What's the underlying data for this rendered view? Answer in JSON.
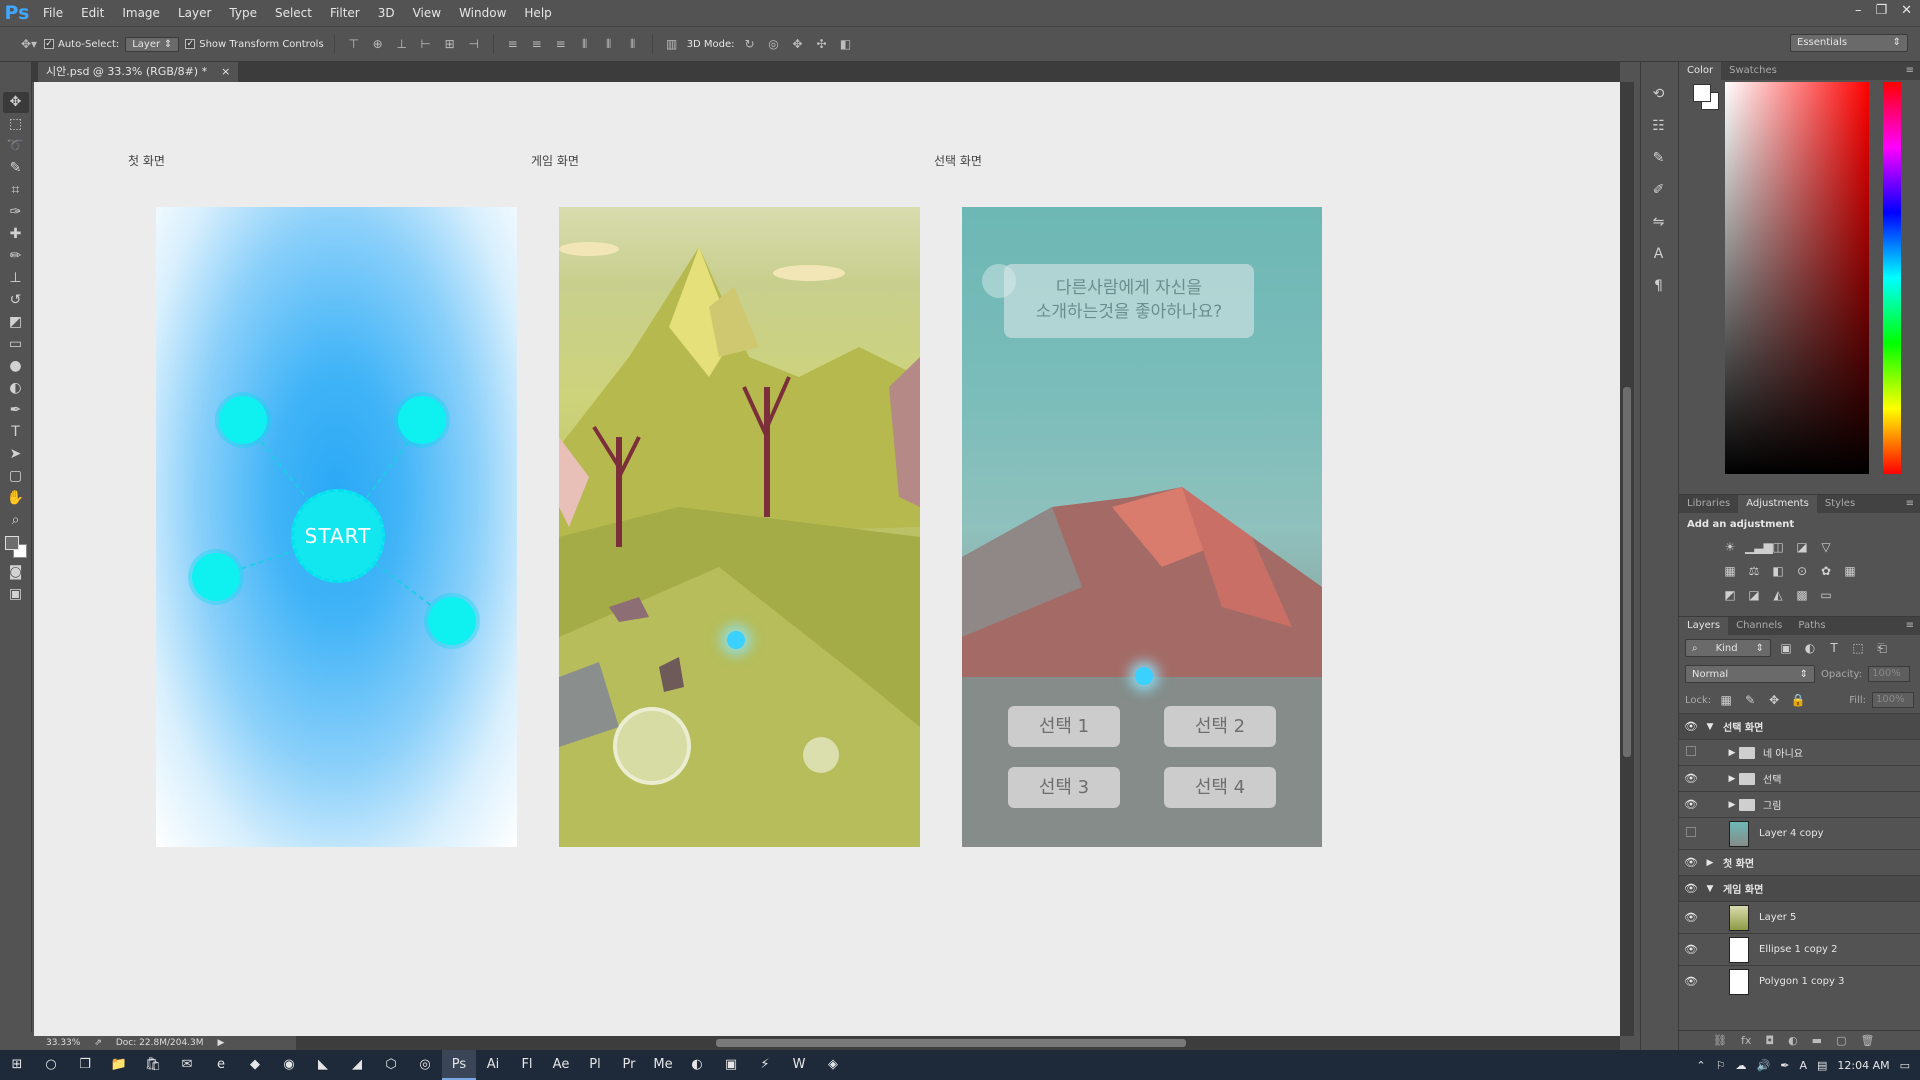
{
  "app": {
    "logo": "Ps",
    "menus": [
      "File",
      "Edit",
      "Image",
      "Layer",
      "Type",
      "Select",
      "Filter",
      "3D",
      "View",
      "Window",
      "Help"
    ]
  },
  "window_controls": {
    "minimize": "–",
    "restore": "❐",
    "close": "✕"
  },
  "options": {
    "auto_select": "Auto-Select:",
    "auto_select_target": "Layer",
    "show_transform": "Show Transform Controls",
    "mode_3d": "3D Mode:",
    "workspace": "Essentials"
  },
  "document": {
    "tab_title": "시안.psd @ 33.3% (RGB/8#) *",
    "close": "×",
    "zoom": "33.33%",
    "doc_size": "Doc: 22.8M/204.3M"
  },
  "artboards": {
    "first": {
      "label": "첫 화면",
      "start": "START"
    },
    "game": {
      "label": "게임 화면"
    },
    "select": {
      "label": "선택 화면",
      "question": "다른사람에게 자신을\n소개하는것을 좋아하나요?",
      "choices": [
        "선택 1",
        "선택 2",
        "선택 3",
        "선택 4"
      ]
    }
  },
  "color_panel": {
    "tabs": [
      "Color",
      "Swatches"
    ]
  },
  "adjust_panel": {
    "tabs": [
      "Libraries",
      "Adjustments",
      "Styles"
    ],
    "title": "Add an adjustment"
  },
  "layers_panel": {
    "tabs": [
      "Layers",
      "Channels",
      "Paths"
    ],
    "kind": "Kind",
    "blend": "Normal",
    "opacity_label": "Opacity:",
    "opacity_value": "100%",
    "lock_label": "Lock:",
    "fill_label": "Fill:",
    "fill_value": "100%",
    "layers": [
      {
        "name": "선택 화면",
        "type": "group",
        "expanded": true,
        "visible": true,
        "indent": 0
      },
      {
        "name": "네 아니요",
        "type": "group",
        "expanded": false,
        "visible": false,
        "indent": 1
      },
      {
        "name": "선택",
        "type": "group",
        "expanded": false,
        "visible": true,
        "indent": 1
      },
      {
        "name": "그림",
        "type": "group",
        "expanded": false,
        "visible": true,
        "indent": 1
      },
      {
        "name": "Layer 4 copy",
        "type": "layer",
        "visible": false,
        "indent": 1
      },
      {
        "name": "첫 화면",
        "type": "group",
        "expanded": false,
        "visible": true,
        "indent": 0
      },
      {
        "name": "게임 화면",
        "type": "group",
        "expanded": true,
        "visible": true,
        "indent": 0
      },
      {
        "name": "Layer 5",
        "type": "layer",
        "visible": true,
        "indent": 1
      },
      {
        "name": "Ellipse 1 copy 2",
        "type": "layer",
        "visible": true,
        "indent": 1
      },
      {
        "name": "Polygon 1 copy 3",
        "type": "layer",
        "visible": true,
        "indent": 1
      }
    ]
  },
  "taskbar": {
    "time": "12:04 AM"
  },
  "colors": {
    "ps_blue": "#3fa7ff",
    "cyan": "#0ff0f0"
  }
}
